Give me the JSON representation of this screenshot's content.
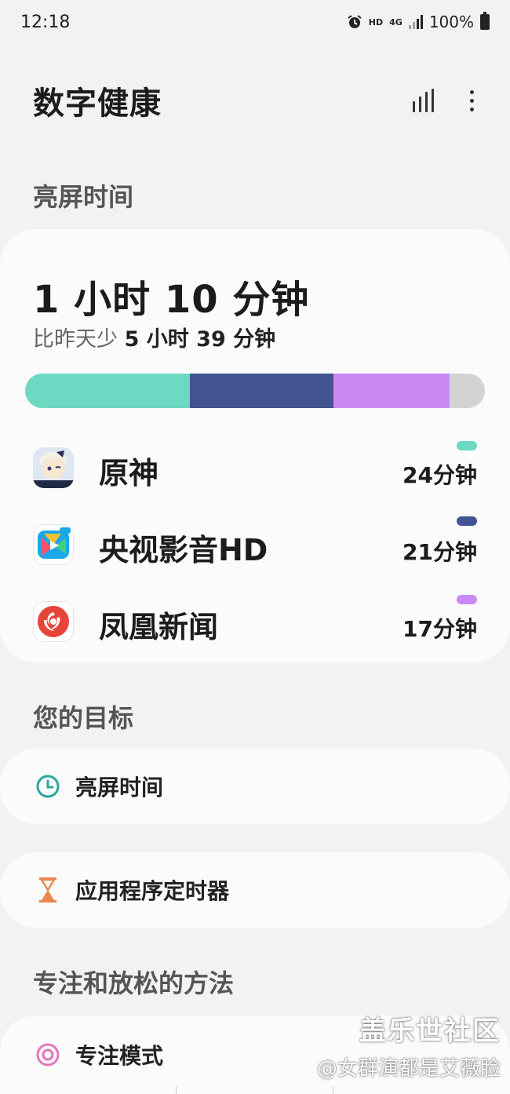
{
  "status_bar": {
    "time": "12:18",
    "hd": "HD",
    "net": "4G",
    "battery": "100%",
    "icons": [
      "alarm-icon",
      "signal-icon",
      "battery-icon"
    ]
  },
  "app_bar": {
    "title": "数字健康",
    "icons": [
      "stats-icon",
      "more-options-icon"
    ]
  },
  "screen_time": {
    "section_title": "亮屏时间",
    "total": "1 小时 10 分钟",
    "compare_prefix": "比昨天少 ",
    "compare_value": "5 小时 39 分钟",
    "usage_segments": [
      {
        "app": "原神",
        "fraction": 0.358,
        "color": "#6dd9c2"
      },
      {
        "app": "央视影音HD",
        "fraction": 0.312,
        "color": "#425491"
      },
      {
        "app": "凤凰新闻",
        "fraction": 0.253,
        "color": "#c98af5"
      },
      {
        "app": "other",
        "fraction": 0.077,
        "color": "#d3d3d3"
      }
    ],
    "apps": [
      {
        "name": "原神",
        "time": "24分钟",
        "color": "#6dd9c2",
        "icon": "genshin-app-icon"
      },
      {
        "name": "央视影音HD",
        "time": "21分钟",
        "color": "#425491",
        "icon": "cctv-video-app-icon"
      },
      {
        "name": "凤凰新闻",
        "time": "17分钟",
        "color": "#c98af5",
        "icon": "ifeng-news-app-icon"
      }
    ]
  },
  "goals": {
    "section_title": "您的目标",
    "items": [
      {
        "label": "亮屏时间",
        "icon": "clock-icon",
        "color": "#2aa6a0"
      },
      {
        "label": "应用程序定时器",
        "icon": "hourglass-icon",
        "color": "#e8884f"
      }
    ]
  },
  "focus": {
    "section_title": "专注和放松的方法",
    "items": [
      {
        "label": "专注模式",
        "icon": "target-icon",
        "color": "#e377b9"
      }
    ]
  },
  "watermark": {
    "line1": "盖乐世社区",
    "line2": "@女群演都是艾薇脸"
  }
}
